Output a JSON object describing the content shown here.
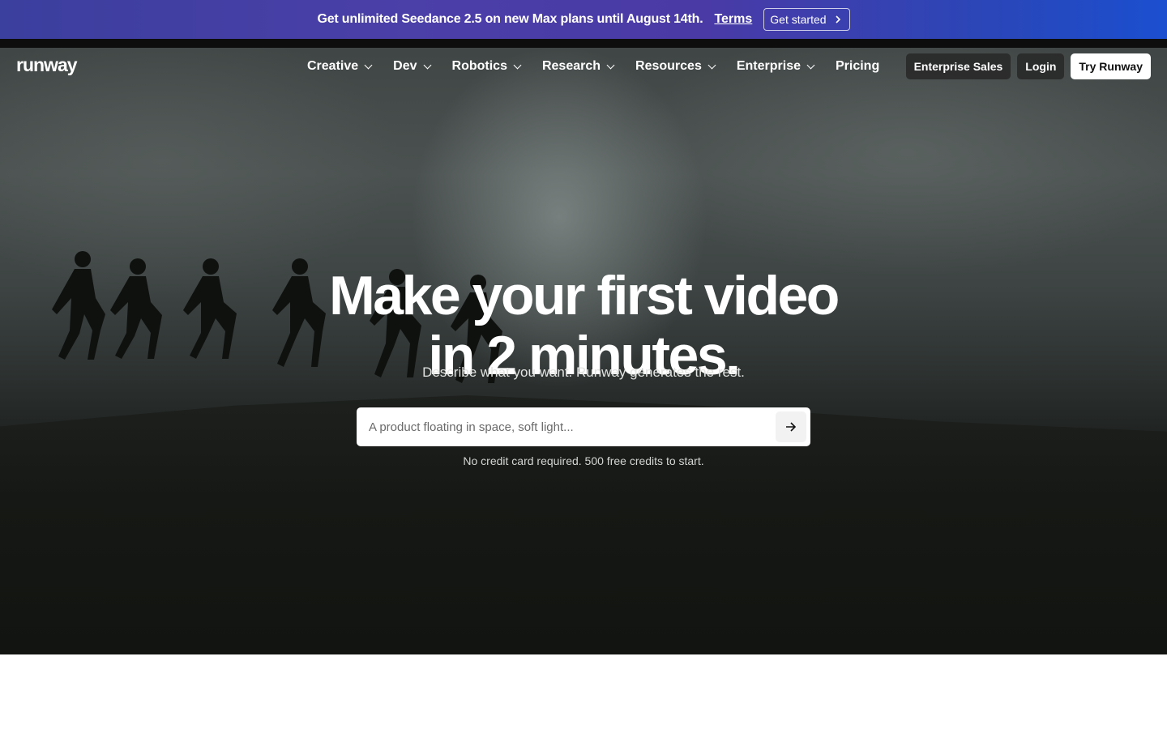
{
  "promo": {
    "text": "Get unlimited Seedance 2.5 on new Max plans until August 14th.",
    "terms": "Terms",
    "cta": "Get started",
    "cta_icon": "chevron-right-icon"
  },
  "nav": {
    "logo": "runway",
    "menu": [
      {
        "label": "Creative",
        "has_dropdown": true
      },
      {
        "label": "Dev",
        "has_dropdown": true
      },
      {
        "label": "Robotics",
        "has_dropdown": true
      },
      {
        "label": "Research",
        "has_dropdown": true
      },
      {
        "label": "Resources",
        "has_dropdown": true
      },
      {
        "label": "Enterprise",
        "has_dropdown": true
      },
      {
        "label": "Pricing",
        "has_dropdown": false
      }
    ],
    "enterprise_sales": "Enterprise Sales",
    "login": "Login",
    "try": "Try Runway"
  },
  "hero": {
    "headline_line1": "Make your first video",
    "headline_line2": "in 2 minutes.",
    "subhead": "Describe what you want. Runway generates the rest.",
    "search_placeholder": "A product floating in space, soft light...",
    "submit_icon": "arrow-right-icon",
    "note": "No credit card required. 500 free credits to start."
  },
  "colors": {
    "promo_gradient_start": "#3b3f9e",
    "promo_gradient_end": "#1b4fd0",
    "try_button_bg": "#ffffff",
    "dark_button_bg": "#282828"
  }
}
